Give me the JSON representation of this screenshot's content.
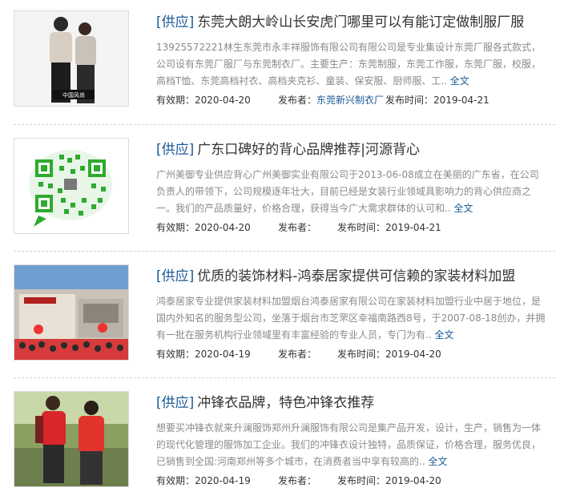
{
  "items": [
    {
      "tag": "[供应]",
      "title": "东莞大朗大岭山长安虎门哪里可以有能订定做制服厂服",
      "desc": "13925572221林生东莞市永丰祥服饰有限公司有限公司是专业集设计东莞厂服各式款式，公司设有东莞厂服厂与东莞制衣厂。主要生产：东莞制服，东莞工作服，东莞厂服，校服，高档T恤、东莞高档衬衣、高档夹克衫、童装、保安服、厨师服、工",
      "more": "全文",
      "valid_label": "有效期：",
      "valid": "2020-04-20",
      "publisher_label": "发布者：",
      "publisher": "东莞新兴制衣厂",
      "time_label": "发布时间：",
      "time": "2019-04-21",
      "image_text": "中国风尚"
    },
    {
      "tag": "[供应]",
      "title": "广东口碑好的背心品牌推荐|河源背心",
      "desc": "广州美御专业供应背心广州美御实业有限公司于2013-06-08成立在美丽的广东省，在公司负责人的带领下，公司规模逐年壮大，目前已经是女装行业领域具影响力的背心供应商之一。我们的产品质量好，价格合理，获得当今广大需求群体的认可和",
      "more": "全文",
      "valid_label": "有效期：",
      "valid": "2020-04-20",
      "publisher_label": "发布者：",
      "publisher": "",
      "time_label": "发布时间：",
      "time": "2019-04-21"
    },
    {
      "tag": "[供应]",
      "title": "优质的装饰材料-鸿泰居家提供可信赖的家装材料加盟",
      "desc": "鸿泰居家专业提供家装材料加盟烟台鸿泰居家有限公司在家装材料加盟行业中居于地位，是国内外知名的服务型公司，坐落于烟台市芝罘区幸福南路西8号，于2007-08-18创办，并拥有一批在服务机构行业领域里有丰富经验的专业人员，专门为有",
      "more": "全文",
      "valid_label": "有效期：",
      "valid": "2020-04-19",
      "publisher_label": "发布者：",
      "publisher": "",
      "time_label": "发布时间：",
      "time": "2019-04-20"
    },
    {
      "tag": "[供应]",
      "title": "冲锋衣品牌，特色冲锋衣推荐",
      "desc": "想要买冲锋衣就来升澜服饰郑州升澜服饰有限公司是集产品开发，设计，生产，销售为一体的现代化管理的服饰加工企业。我们的冲锋衣设计独特，品质保证，价格合理，服务优良，已销售到全国:河南郑州等多个城市，在消费者当中享有较高的",
      "more": "全文",
      "valid_label": "有效期：",
      "valid": "2020-04-19",
      "publisher_label": "发布者：",
      "publisher": "",
      "time_label": "发布时间：",
      "time": "2019-04-20"
    }
  ]
}
